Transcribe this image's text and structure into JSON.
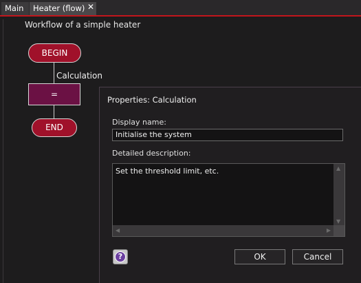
{
  "tabs": {
    "main": "Main",
    "heater": "Heater (flow)",
    "close": "✕"
  },
  "canvas": {
    "title": "Workflow of a simple heater",
    "nodes": {
      "begin": "BEGIN",
      "calc_symbol": "=",
      "calc_label": "Calculation",
      "end": "END"
    }
  },
  "dialog": {
    "title": "Properties: Calculation",
    "display_name_label": "Display name:",
    "display_name_value": "Initialise the system",
    "description_label": "Detailed description:",
    "description_value": "Set the threshold limit, etc.",
    "help_icon": "?",
    "ok": "OK",
    "cancel": "Cancel"
  },
  "colors": {
    "tab_accent": "#c3161c",
    "begin_end_node": "#a0112a",
    "calc_node": "#6b1144",
    "help_icon": "#6b3fa0"
  }
}
